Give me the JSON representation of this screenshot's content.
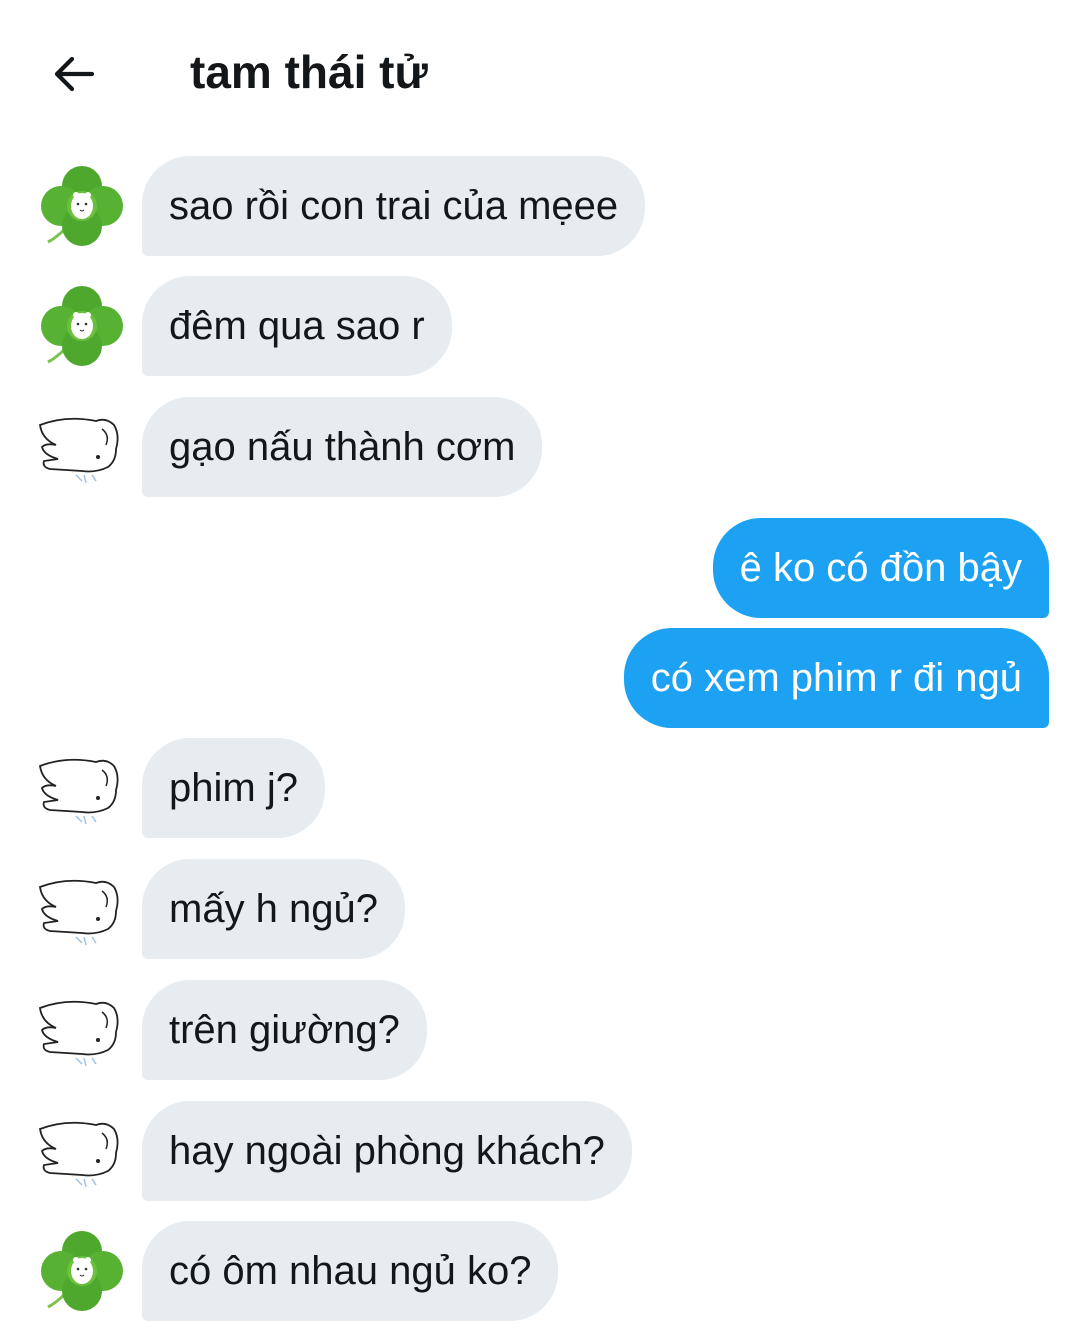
{
  "header": {
    "back_icon": "arrow-left-icon",
    "title": "tam thái tử"
  },
  "avatars": {
    "clover": "four-leaf-clover-avatar",
    "sketch": "sketch-animal-avatar"
  },
  "colors": {
    "incoming_bubble": "#e6ecf0",
    "outgoing_bubble": "#1da1f2",
    "text": "#14171a"
  },
  "messages": [
    {
      "direction": "in",
      "avatar": "clover",
      "text": "sao rồi con trai của mẹee"
    },
    {
      "direction": "in",
      "avatar": "clover",
      "text": "đêm qua sao r"
    },
    {
      "direction": "in",
      "avatar": "sketch",
      "text": "gạo nấu thành cơm"
    },
    {
      "direction": "out",
      "text": "ê ko có đồn bậy"
    },
    {
      "direction": "out",
      "text": "có xem phim r đi ngủ"
    },
    {
      "direction": "in",
      "avatar": "sketch",
      "text": "phim j?"
    },
    {
      "direction": "in",
      "avatar": "sketch",
      "text": "mấy h ngủ?"
    },
    {
      "direction": "in",
      "avatar": "sketch",
      "text": "trên giường?"
    },
    {
      "direction": "in",
      "avatar": "sketch",
      "text": "hay ngoài phòng khách?"
    },
    {
      "direction": "in",
      "avatar": "clover",
      "text": "có ôm nhau ngủ ko?"
    }
  ]
}
